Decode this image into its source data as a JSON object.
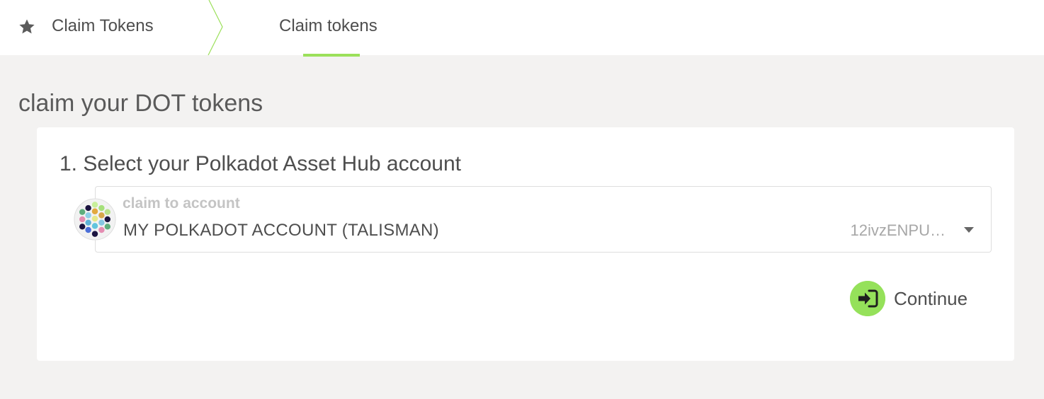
{
  "nav": {
    "section_label": "Claim Tokens",
    "section_icon": "star-icon",
    "active_tab_label": "Claim tokens",
    "accent_color": "#9be05a"
  },
  "page": {
    "title": "claim your DOT tokens"
  },
  "step1": {
    "title": "1. Select your Polkadot Asset Hub account",
    "dropdown": {
      "label": "claim to account",
      "selected_account": "MY POLKADOT ACCOUNT (TALISMAN)",
      "address": "12ivzENPU…",
      "avatar_icon": "identicon-avatar",
      "caret_icon": "caret-down-icon"
    },
    "continue_label": "Continue",
    "continue_icon": "sign-in-arrow-icon"
  }
}
